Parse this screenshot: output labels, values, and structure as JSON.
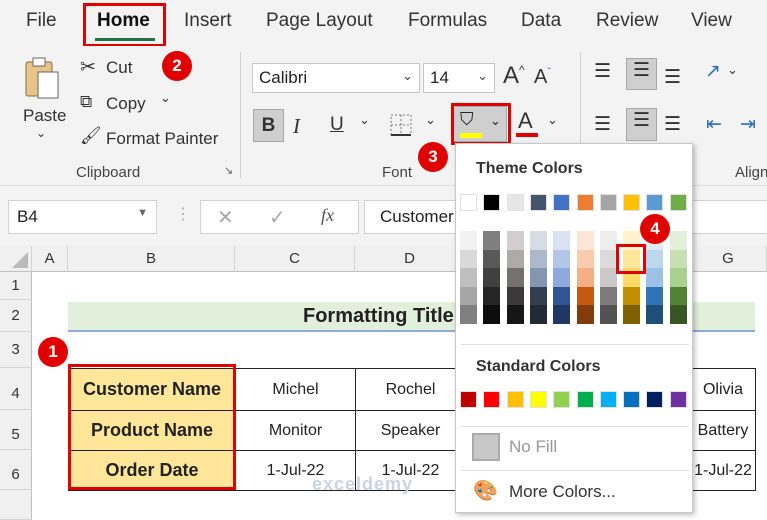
{
  "menu": {
    "tabs": [
      "File",
      "Home",
      "Insert",
      "Page Layout",
      "Formulas",
      "Data",
      "Review",
      "View"
    ],
    "active": "Home"
  },
  "ribbon": {
    "clipboard": {
      "paste": "Paste",
      "cut": "Cut",
      "copy": "Copy",
      "format_painter": "Format Painter",
      "group_label": "Clipboard"
    },
    "font": {
      "font_name": "Calibri",
      "font_size": "14",
      "bold": "B",
      "italic": "I",
      "underline": "U",
      "font_color_letter": "A",
      "group_label": "Font",
      "fill_color": "#ffff00",
      "font_color": "#e00000"
    },
    "alignment": {
      "group_label": "Align"
    }
  },
  "formula_bar": {
    "name_box": "B4",
    "fx": "fx",
    "content": "Customer Name"
  },
  "columns": [
    "A",
    "B",
    "C",
    "D",
    "G"
  ],
  "rows": [
    "1",
    "2",
    "3",
    "4",
    "5",
    "6"
  ],
  "sheet": {
    "title": "Formatting Title",
    "table": [
      [
        "Customer Name",
        "Michel",
        "Rochel",
        "Olivia"
      ],
      [
        "Product Name",
        "Monitor",
        "Speaker",
        "Battery"
      ],
      [
        "Order Date",
        "1-Jul-22",
        "1-Jul-22",
        "1-Jul-22"
      ]
    ],
    "header_fill": "#ffe699",
    "title_fill": "#e2efda"
  },
  "fill_dropdown": {
    "theme_label": "Theme Colors",
    "theme_colors": [
      "#ffffff",
      "#000000",
      "#e7e6e6",
      "#44546a",
      "#4472c4",
      "#ed7d31",
      "#a5a5a5",
      "#ffc000",
      "#5b9bd5",
      "#70ad47"
    ],
    "shades": [
      [
        "#f2f2f2",
        "#d9d9d9",
        "#bfbfbf",
        "#a6a6a6",
        "#808080"
      ],
      [
        "#7f7f7f",
        "#595959",
        "#404040",
        "#262626",
        "#0d0d0d"
      ],
      [
        "#d0cece",
        "#aeaaaa",
        "#757171",
        "#3a3838",
        "#171616"
      ],
      [
        "#d6dce4",
        "#acb9ca",
        "#8496b0",
        "#333f4f",
        "#222b35"
      ],
      [
        "#d9e1f2",
        "#b4c6e7",
        "#8ea9db",
        "#2f5597",
        "#203764"
      ],
      [
        "#fce4d6",
        "#f8cbad",
        "#f4b084",
        "#c65911",
        "#833c0c"
      ],
      [
        "#ededed",
        "#dbdbdb",
        "#c9c9c9",
        "#7b7b7b",
        "#525252"
      ],
      [
        "#fff2cc",
        "#ffe699",
        "#ffd966",
        "#bf8f00",
        "#806000"
      ],
      [
        "#ddebf7",
        "#bdd7ee",
        "#9bc2e6",
        "#2f75b5",
        "#1f4e78"
      ],
      [
        "#e2efda",
        "#c6e0b4",
        "#a9d08e",
        "#548235",
        "#375623"
      ]
    ],
    "selected": "#ffe699",
    "standard_label": "Standard Colors",
    "standard_colors": [
      "#c00000",
      "#ff0000",
      "#ffc000",
      "#ffff00",
      "#92d050",
      "#00b050",
      "#00b0f0",
      "#0070c0",
      "#002060",
      "#7030a0"
    ],
    "no_fill": "No Fill",
    "more_colors": "More Colors..."
  },
  "badges": [
    "1",
    "2",
    "3",
    "4"
  ],
  "watermark": "exceldemy"
}
